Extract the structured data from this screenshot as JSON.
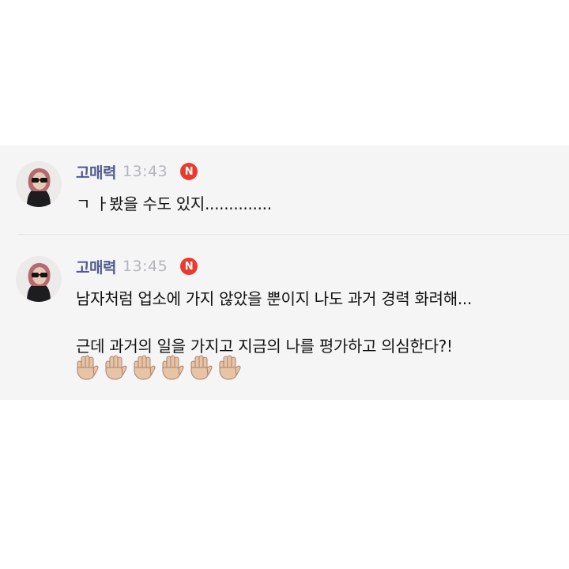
{
  "messages": [
    {
      "sender": "고매력",
      "time": "13:43",
      "badge": "N",
      "lines": [
        "ㄱ ㅏ봤을 수도 있지.............."
      ]
    },
    {
      "sender": "고매력",
      "time": "13:45",
      "badge": "N",
      "lines": [
        "남자처럼 업소에 가지 않았을 뿐이지 나도 과거 경력 화려해...",
        "근데 과거의 일을 가지고 지금의 나를 평가하고 의심한다?!"
      ],
      "emoji": {
        "icon": "raised-hand-icon",
        "count": 6,
        "skin_color": "#e8c4a6"
      }
    }
  ],
  "colors": {
    "panel_bg": "#f5f5f6",
    "sender": "#4f5a8e",
    "time": "#b4b6bd",
    "badge_bg": "#e83a2d"
  }
}
